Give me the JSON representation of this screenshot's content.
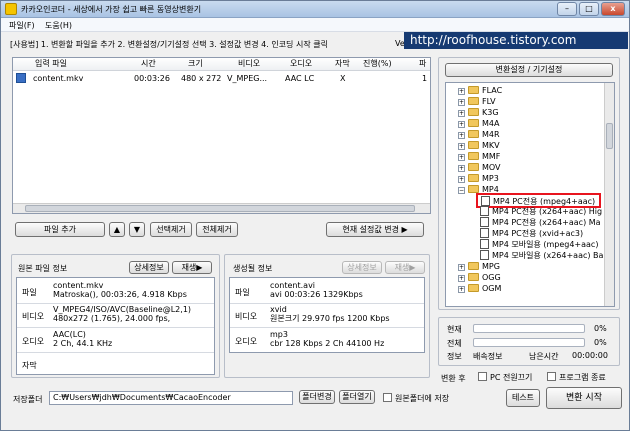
{
  "window": {
    "title": "카카오인코더 - 세상에서 가장 쉽고 빠른 동영상변환기",
    "min": "–",
    "max": "□",
    "close": "x"
  },
  "menu": [
    "파일(F)",
    "도움(H)"
  ],
  "steps_text": "[사용법] 1. 변환할 파일을 추가  2. 변환설정/기기설정 선택  3. 설정값 변경  4. 인코딩 시작 클릭",
  "version_text": "Ver",
  "watermark": "http://roofhouse.tistory.com",
  "file_table": {
    "headers": [
      "입력 파일",
      "시간",
      "크기",
      "비디오",
      "오디오",
      "자막",
      "진행(%)",
      "파"
    ],
    "rows": [
      {
        "name": "content.mkv",
        "time": "00:03:26",
        "size": "480 x 272",
        "video": "V_MPEG...",
        "audio": "AAC LC",
        "subtitle": "X",
        "progress": "",
        "extra": "1"
      }
    ]
  },
  "file_buttons": {
    "add": "파일 추가",
    "up": "▲",
    "down": "▼",
    "remove_selected": "선택제거",
    "remove_all": "전체제거",
    "change_settings": "현재 설정값 변경 ▶"
  },
  "source_info": {
    "title": "원본 파일 정보",
    "detail_button": "상세정보",
    "play_button": "재생▶",
    "rows": [
      {
        "label": "파일",
        "line1": "content.mkv",
        "line2": "Matroska(), 00:03:26, 4.918 Kbps"
      },
      {
        "label": "비디오",
        "line1": "V_MPEG4/ISO/AVC(Baseline@L2,1)",
        "line2": "480x272 (1.765), 24.000 fps,"
      },
      {
        "label": "오디오",
        "line1": "AAC(LC)",
        "line2": "2 Ch, 44.1 KHz"
      },
      {
        "label": "자막",
        "line1": "",
        "line2": ""
      }
    ]
  },
  "output_info": {
    "title": "생성될 정보",
    "detail_button": "상세정보",
    "play_button": "재생▶",
    "rows": [
      {
        "label": "파일",
        "line1": "content.avi",
        "line2": "avi   00:03:26   1329Kbps"
      },
      {
        "label": "비디오",
        "line1": "xvid",
        "line2": "원본크기  29.970 fps   1200 Kbps"
      },
      {
        "label": "오디오",
        "line1": "mp3",
        "line2": "cbr     128 Kbps  2 Ch   44100 Hz"
      }
    ]
  },
  "settings_panel": {
    "header": "변환설정 / 기기설정",
    "tree": [
      {
        "type": "folder",
        "label": "FLAC"
      },
      {
        "type": "folder",
        "label": "FLV"
      },
      {
        "type": "folder",
        "label": "K3G"
      },
      {
        "type": "folder",
        "label": "M4A"
      },
      {
        "type": "folder",
        "label": "M4R"
      },
      {
        "type": "folder",
        "label": "MKV"
      },
      {
        "type": "folder",
        "label": "MMF"
      },
      {
        "type": "folder",
        "label": "MOV"
      },
      {
        "type": "folder",
        "label": "MP3"
      },
      {
        "type": "folder-open",
        "label": "MP4"
      },
      {
        "type": "item",
        "label": "MP4 PC전용 (mpeg4+aac)",
        "highlight": true
      },
      {
        "type": "item",
        "label": "MP4 PC전용 (x264+aac) Hig"
      },
      {
        "type": "item",
        "label": "MP4 PC전용 (x264+aac) Ma"
      },
      {
        "type": "item",
        "label": "MP4 PC전용 (xvid+ac3)"
      },
      {
        "type": "item",
        "label": "MP4 모바일용 (mpeg4+aac)"
      },
      {
        "type": "item",
        "label": "MP4 모바일용 (x264+aac) Ba"
      },
      {
        "type": "folder",
        "label": "MPG"
      },
      {
        "type": "folder",
        "label": "OGG"
      },
      {
        "type": "folder",
        "label": "OGM"
      }
    ],
    "highlight_color": "#e8141e"
  },
  "progress": {
    "current_label": "현재",
    "current_value": "0%",
    "total_label": "전체",
    "total_value": "0%",
    "info_label": "정보",
    "speed_label": "배속정보",
    "remaining_label": "남은시간",
    "remaining_value": "00:00:00"
  },
  "after_convert": {
    "label": "변환 후",
    "pc_off": "PC 전원끄기",
    "program_exit": "프로그램 종료"
  },
  "save_folder": {
    "label": "저장폴더",
    "path": "C:₩Users₩jdh₩Documents₩CacaoEncoder",
    "change_button": "폴더변경",
    "open_button": "폴더열기",
    "same_as_source": "원본폴더에 저장"
  },
  "bottom_buttons": {
    "test": "테스트",
    "start": "변환 시작"
  }
}
